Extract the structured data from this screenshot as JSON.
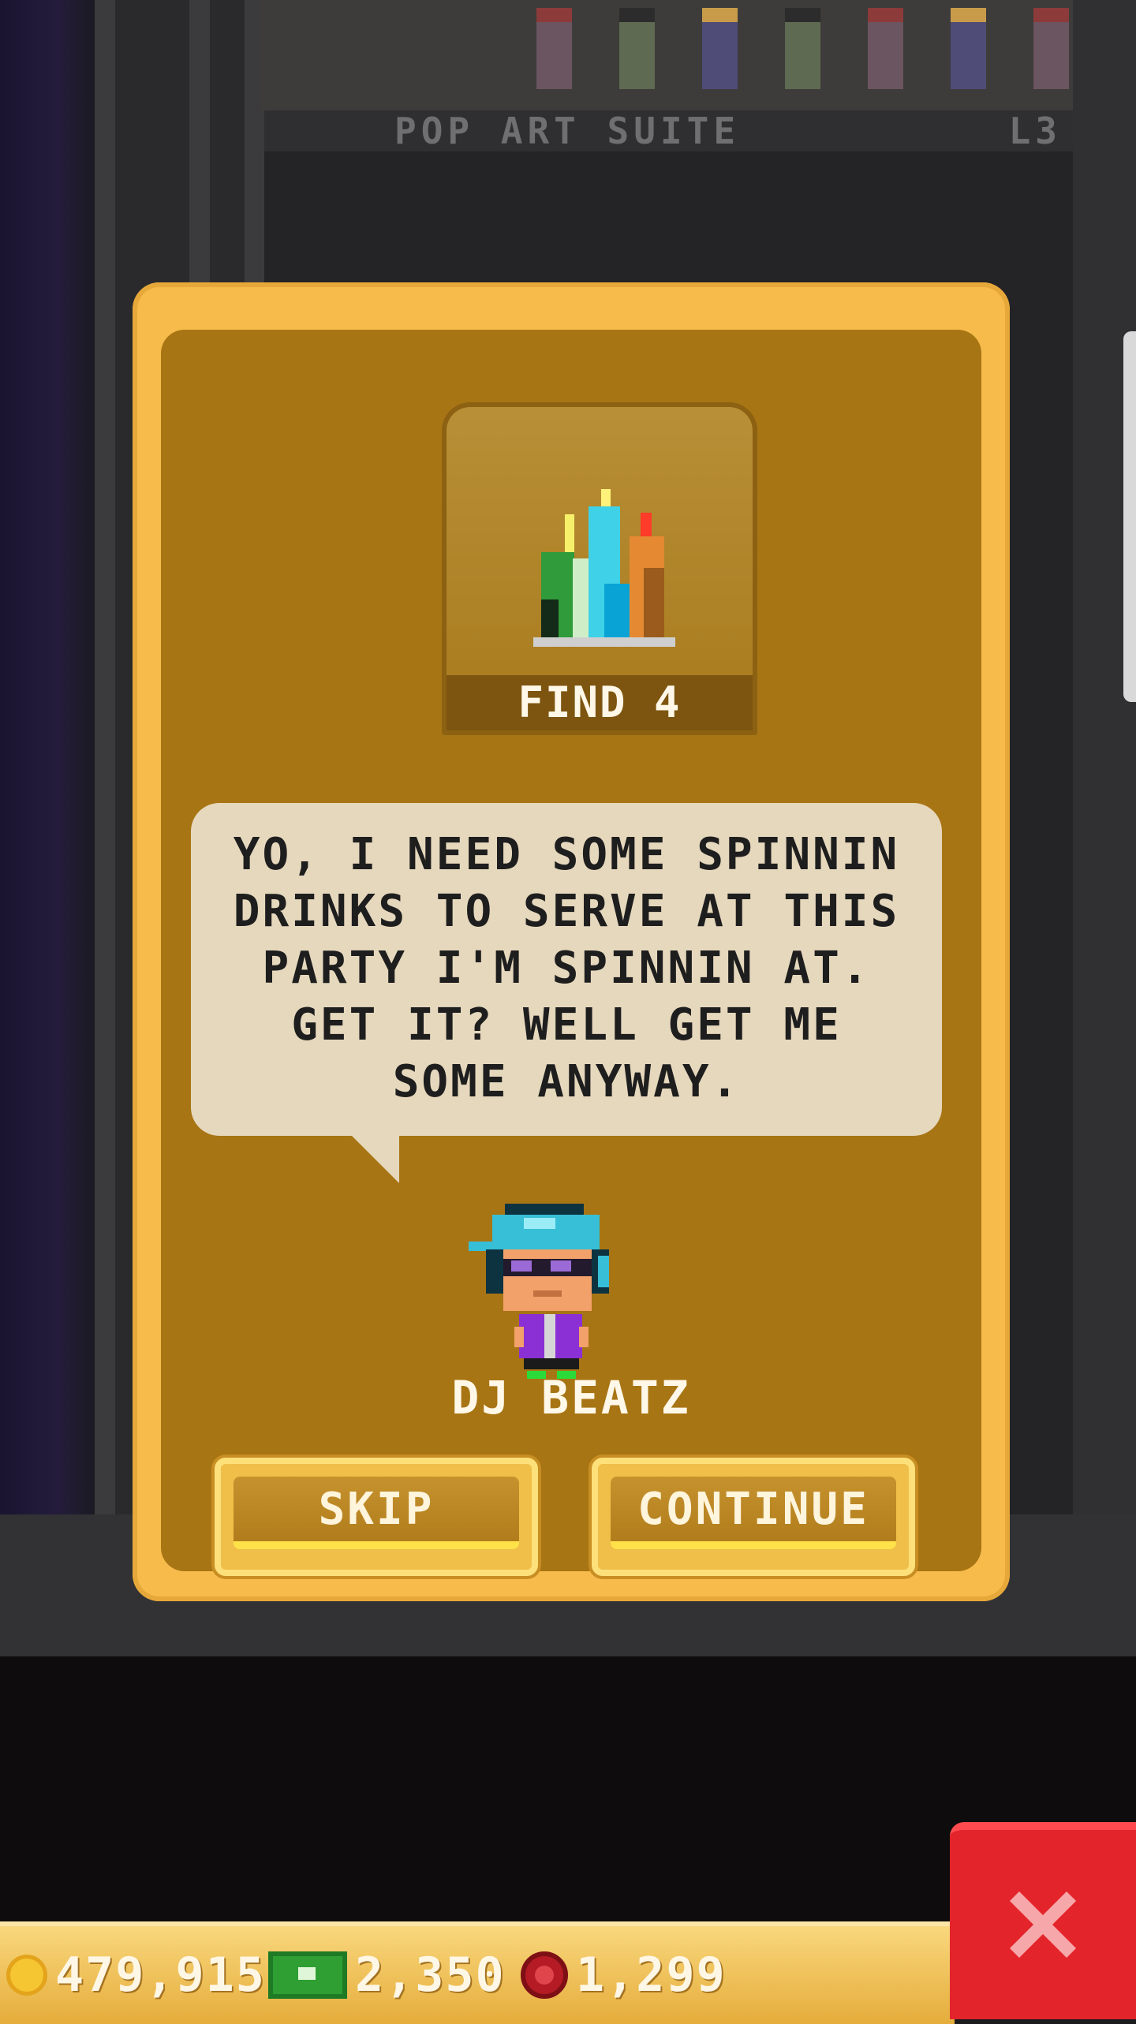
{
  "background": {
    "floor_name": "POP ART SUITE",
    "floor_level": "L3"
  },
  "mission": {
    "label": "FIND 4",
    "icon": "drinks-icon"
  },
  "dialog": {
    "text": "YO, I NEED SOME SPINNIN DRINKS TO SERVE AT THIS PARTY I'M SPINNIN AT. GET IT? WELL GET ME SOME ANYWAY."
  },
  "character": {
    "name": "DJ BEATZ",
    "icon": "dj-character-avatar"
  },
  "buttons": {
    "skip_label": "SKIP",
    "continue_label": "CONTINUE"
  },
  "currency": {
    "coins": "479,915",
    "bux": "2,350",
    "chips": "1,299"
  },
  "colors": {
    "modal_border": "#f6bb4b",
    "modal_body": "#a87514",
    "bubble": "#e6d8bd",
    "close_button": "#e4242b"
  }
}
